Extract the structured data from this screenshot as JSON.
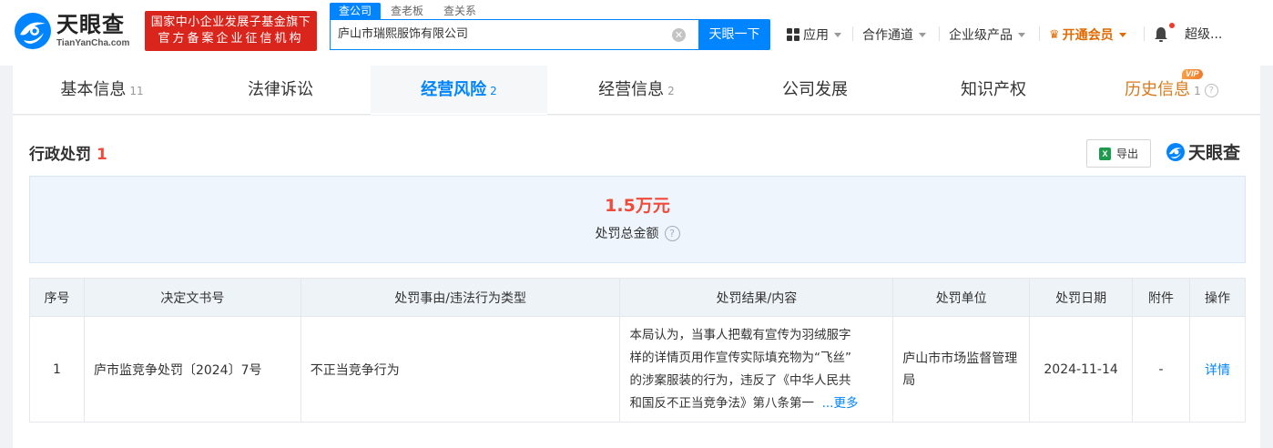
{
  "header": {
    "logo_cn": "天眼查",
    "logo_en": "TianYanCha.com",
    "slogan_line1": "国家中小企业发展子基金旗下",
    "slogan_line2": "官方备案企业征信机构",
    "search_tabs": [
      "查公司",
      "查老板",
      "查关系"
    ],
    "search_value": "庐山市瑞熙服饰有限公司",
    "search_button": "天眼一下",
    "nav": {
      "apps": "应用",
      "cooperation": "合作通道",
      "enterprise": "企业级产品",
      "vip": "开通会员",
      "user": "超级..."
    }
  },
  "tabs": [
    {
      "label": "基本信息",
      "count": "11"
    },
    {
      "label": "法律诉讼",
      "count": ""
    },
    {
      "label": "经营风险",
      "count": "2"
    },
    {
      "label": "经营信息",
      "count": "2"
    },
    {
      "label": "公司发展",
      "count": ""
    },
    {
      "label": "知识产权",
      "count": ""
    },
    {
      "label": "历史信息",
      "count": "1"
    }
  ],
  "vip_badge": "VIP",
  "section": {
    "title": "行政处罚",
    "count": "1",
    "export_label": "导出",
    "brand": "天眼查"
  },
  "summary": {
    "amount": "1.5万元",
    "label": "处罚总金额"
  },
  "table": {
    "headers": [
      "序号",
      "决定文书号",
      "处罚事由/违法行为类型",
      "处罚结果/内容",
      "处罚单位",
      "处罚日期",
      "附件",
      "操作"
    ],
    "rows": [
      {
        "index": "1",
        "doc_no": "庐市监竞争处罚〔2024〕7号",
        "reason": "不正当竞争行为",
        "result_lines": [
          "本局认为，当事人把载有宣传为羽绒服字",
          "样的详情页用作宣传实际填充物为“飞丝”",
          "的涉案服装的行为，违反了《中华人民共",
          "和国反不正当竞争法》第八条第一"
        ],
        "result_more": "...更多",
        "authority": "庐山市市场监督管理局",
        "date": "2024-11-14",
        "attachment": "-",
        "action": "详情"
      }
    ]
  },
  "colors": {
    "brand_blue": "#0084ff",
    "alert_red": "#f04a3a",
    "slogan_red": "#d9251c",
    "vip_orange": "#e06a00"
  }
}
